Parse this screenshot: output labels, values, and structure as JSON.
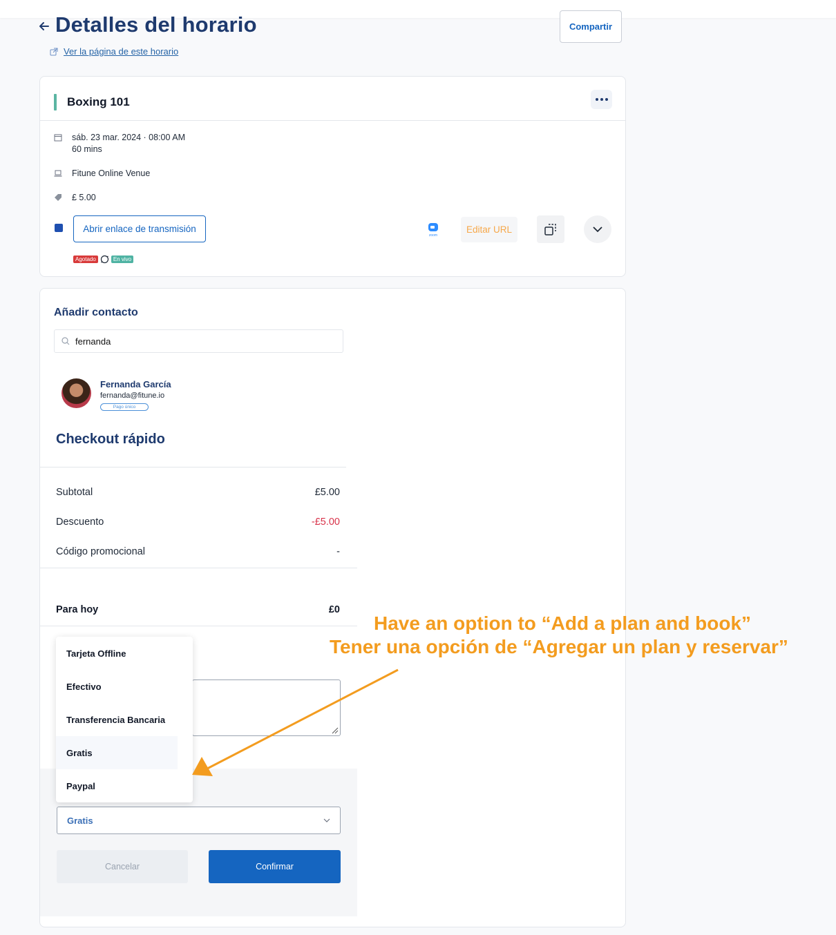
{
  "header": {
    "title": "Detalles del horario",
    "view_link": "Ver la página de este horario",
    "share_button": "Compartir"
  },
  "event": {
    "name": "Boxing 101",
    "datetime": "sáb. 23 mar. 2024 · 08:00 AM",
    "duration": "60 mins",
    "venue": "Fitune Online Venue",
    "price": "£ 5.00",
    "stream_button": "Abrir enlace de transmisión",
    "zoom_label": "zoom",
    "edit_url_button": "Editar URL",
    "badges": {
      "sold_out": "Agotado",
      "live": "En vivo"
    }
  },
  "contact": {
    "section_title": "Añadir contacto",
    "search_value": "fernanda",
    "name": "Fernanda García",
    "email": "fernanda@fitune.io",
    "payment_type": "Pago único"
  },
  "checkout": {
    "title": "Checkout rápido",
    "rows": [
      {
        "label": "Subtotal",
        "value": "£5.00"
      },
      {
        "label": "Descuento",
        "value": "-£5.00"
      },
      {
        "label": "Código promocional",
        "value": "-"
      }
    ],
    "total_label": "Para hoy",
    "total_value": "£0",
    "payment_selected": "Gratis",
    "cancel_button": "Cancelar",
    "confirm_button": "Confirmar"
  },
  "payment_options": [
    "Tarjeta Offline",
    "Efectivo",
    "Transferencia Bancaria",
    "Gratis",
    "Paypal"
  ],
  "annotation": {
    "line1": "Have an option to “Add a plan and book”",
    "line2": "Tener una opción de “Agregar un plan y reservar”",
    "color": "#f39c1f"
  },
  "colors": {
    "primary": "#1565c0",
    "title": "#1e3a6e",
    "accent": "#5bb5a2",
    "negative": "#d8334a"
  }
}
